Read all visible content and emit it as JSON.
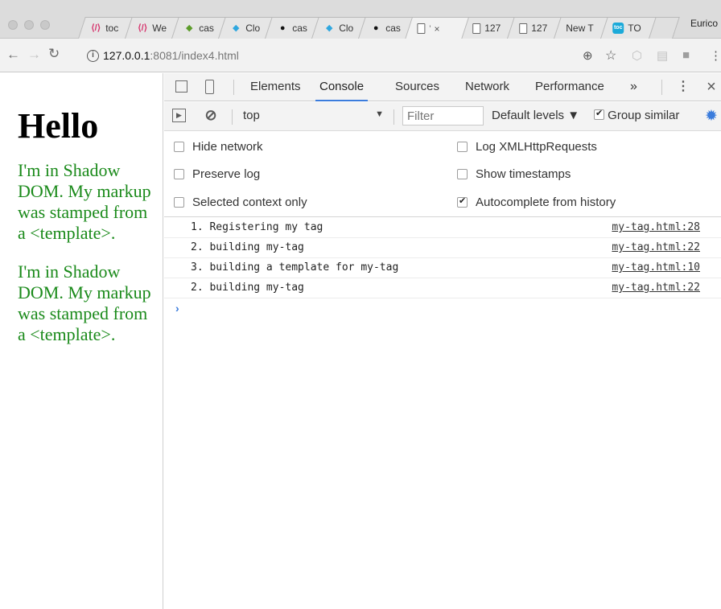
{
  "browser": {
    "tabs": [
      {
        "label": "toc",
        "icon": "polymer-icon",
        "glyph": "⟨/⟩"
      },
      {
        "label": "We",
        "icon": "polymer-icon",
        "glyph": "⟨/⟩"
      },
      {
        "label": "cas",
        "icon": "clarity-logo-icon",
        "glyph": "◆"
      },
      {
        "label": "Clo",
        "icon": "clarity-icon",
        "glyph": "◆"
      },
      {
        "label": "cas",
        "icon": "github-icon",
        "glyph": "●"
      },
      {
        "label": "Clo",
        "icon": "clarity-icon",
        "glyph": "◆"
      },
      {
        "label": "cas",
        "icon": "github-icon",
        "glyph": "●"
      },
      {
        "label": "",
        "icon": "document-icon",
        "glyph": ""
      },
      {
        "label": "127",
        "icon": "document-icon",
        "glyph": ""
      },
      {
        "label": "127",
        "icon": "document-icon",
        "glyph": ""
      },
      {
        "label": "New T",
        "icon": "",
        "glyph": ""
      },
      {
        "label": "TO",
        "icon": "toc-icon",
        "glyph": "toc"
      }
    ],
    "active_tab_close": "×",
    "profile_name": "Eurico",
    "url_host": "127.0.0.1",
    "url_rest": ":8081/index4.html",
    "info_glyph": "i"
  },
  "page": {
    "heading": "Hello",
    "paragraphs": [
      "I'm in Shadow DOM. My markup was stamped from a <template>.",
      "I'm in Shadow DOM. My markup was stamped from a <template>."
    ],
    "text_color": "#1a8a1a"
  },
  "devtools": {
    "tabs": [
      "Elements",
      "Console",
      "Sources",
      "Network",
      "Performance"
    ],
    "active_tab": "Console",
    "more_tabs": "»",
    "menu": "⋮",
    "close": "×",
    "context": "top",
    "filter_placeholder": "Filter",
    "levels": "Default levels ▼",
    "group_similar": "Group similar",
    "settings": {
      "hide_network": "Hide network",
      "log_xhr": "Log XMLHttpRequests",
      "preserve_log": "Preserve log",
      "show_timestamps": "Show timestamps",
      "selected_context": "Selected context only",
      "autocomplete": "Autocomplete from history"
    },
    "messages": [
      {
        "text": "1. Registering my tag",
        "source": "my-tag.html:28"
      },
      {
        "text": "2. building my-tag",
        "source": "my-tag.html:22"
      },
      {
        "text": "3. building a template for my-tag",
        "source": "my-tag.html:10"
      },
      {
        "text": "2. building my-tag",
        "source": "my-tag.html:22"
      }
    ],
    "prompt": "›",
    "accent": "#3b7cdc"
  }
}
